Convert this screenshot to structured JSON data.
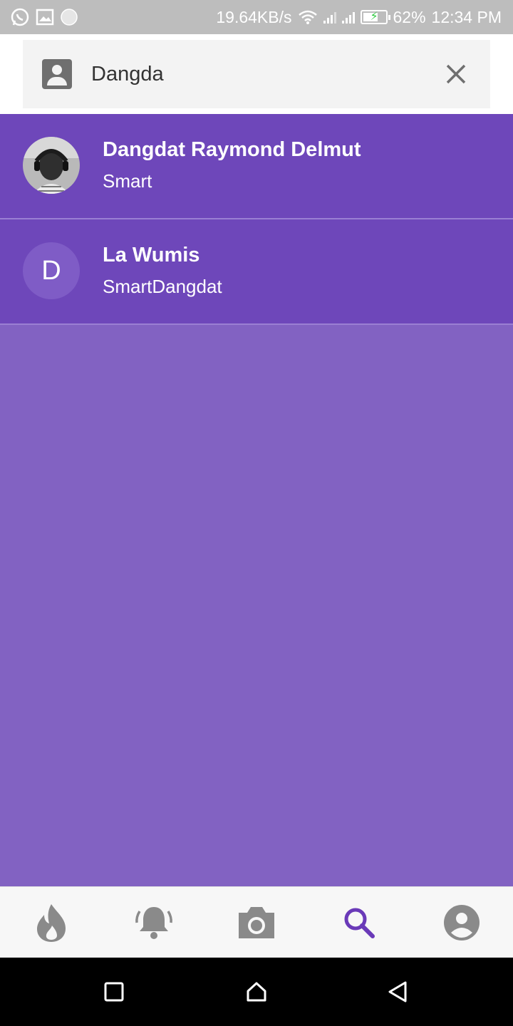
{
  "status_bar": {
    "net_speed": "19.64KB/s",
    "battery": "62%",
    "time": "12:34 PM",
    "icons": [
      "whatsapp-icon",
      "gallery-icon",
      "circle-notification-icon",
      "wifi-icon",
      "signal-icon",
      "signal-icon",
      "battery-charging-icon"
    ]
  },
  "search": {
    "value": "Dangda",
    "placeholder": "",
    "leading_icon": "contact-icon",
    "clear_icon": "close-icon"
  },
  "results": [
    {
      "name": "Dangdat Raymond Delmut",
      "subtitle": "Smart",
      "avatar": "photo"
    },
    {
      "name": "La Wumis",
      "subtitle": "SmartDangdat",
      "avatar_letter": "D"
    }
  ],
  "bottom_nav": {
    "items": [
      "flame-icon",
      "bell-icon",
      "camera-icon",
      "search-icon",
      "profile-icon"
    ],
    "active": "search-icon"
  },
  "colors": {
    "list_bg": "#6e47ba",
    "page_bg": "#8262c2",
    "accent": "#6a3ab8",
    "nav_inactive": "#8a8a8a"
  }
}
